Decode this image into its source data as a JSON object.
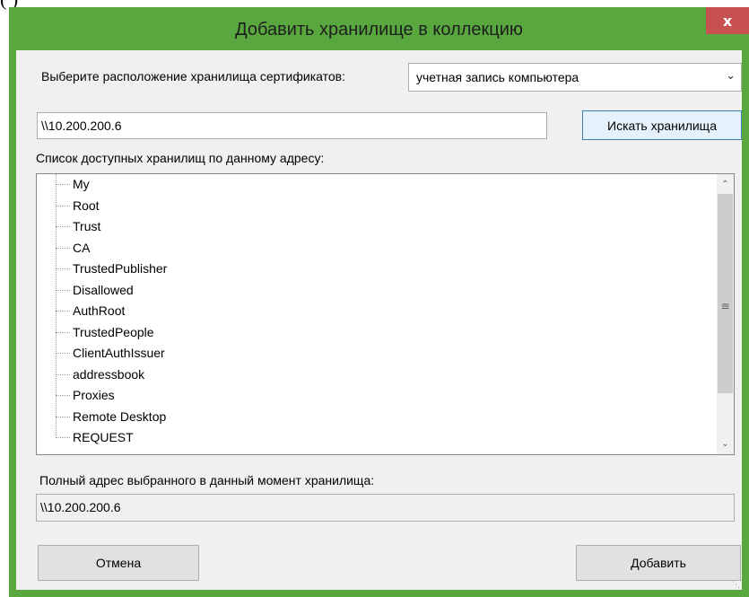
{
  "page_fragment": "(        )",
  "window": {
    "title": "Добавить хранилище в коллекцию",
    "close_glyph": "x"
  },
  "location": {
    "label": "Выберите расположение хранилища сертификатов:",
    "selected": "учетная запись компьютера"
  },
  "address_input": {
    "value": "\\\\10.200.200.6"
  },
  "search_button": "Искать хранилища",
  "list": {
    "label": "Список доступных хранилищ по данному адресу:",
    "items": [
      "My",
      "Root",
      "Trust",
      "CA",
      "TrustedPublisher",
      "Disallowed",
      "AuthRoot",
      "TrustedPeople",
      "ClientAuthIssuer",
      "addressbook",
      "Proxies",
      "Remote Desktop",
      "REQUEST"
    ]
  },
  "full_address": {
    "label": "Полный адрес выбранного в данный момент хранилища:",
    "value": "\\\\10.200.200.6"
  },
  "buttons": {
    "cancel": "Отмена",
    "add": "Добавить"
  },
  "colors": {
    "frame": "#59a73f",
    "close": "#c75050",
    "client": "#f0f0f0"
  }
}
